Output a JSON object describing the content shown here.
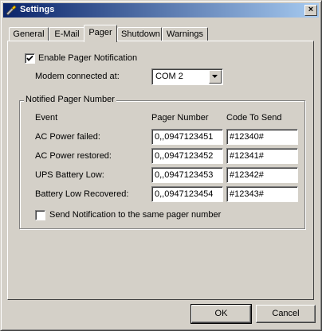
{
  "window": {
    "title": "Settings",
    "close_symbol": "×"
  },
  "tabs": [
    "General",
    "E-Mail",
    "Pager",
    "Shutdown",
    "Warnings"
  ],
  "active_tab": "Pager",
  "pager": {
    "enable_label": "Enable Pager Notification",
    "enable_checked": true,
    "modem_label": "Modem connected at:",
    "modem_value": "COM 2",
    "group_title": "Notified Pager Number",
    "columns": {
      "event": "Event",
      "pager_number": "Pager Number",
      "code": "Code To Send"
    },
    "rows": [
      {
        "event": "AC Power failed:",
        "pager_number": "0,,0947123451",
        "code": "#12340#"
      },
      {
        "event": "AC Power restored:",
        "pager_number": "0,,0947123452",
        "code": "#12341#"
      },
      {
        "event": "UPS Battery Low:",
        "pager_number": "0,,0947123453",
        "code": "#12342#"
      },
      {
        "event": "Battery Low Recovered:",
        "pager_number": "0,,0947123454",
        "code": "#12343#"
      }
    ],
    "same_number_label": "Send Notification to the same pager number",
    "same_number_checked": false
  },
  "buttons": {
    "ok": "OK",
    "cancel": "Cancel"
  }
}
